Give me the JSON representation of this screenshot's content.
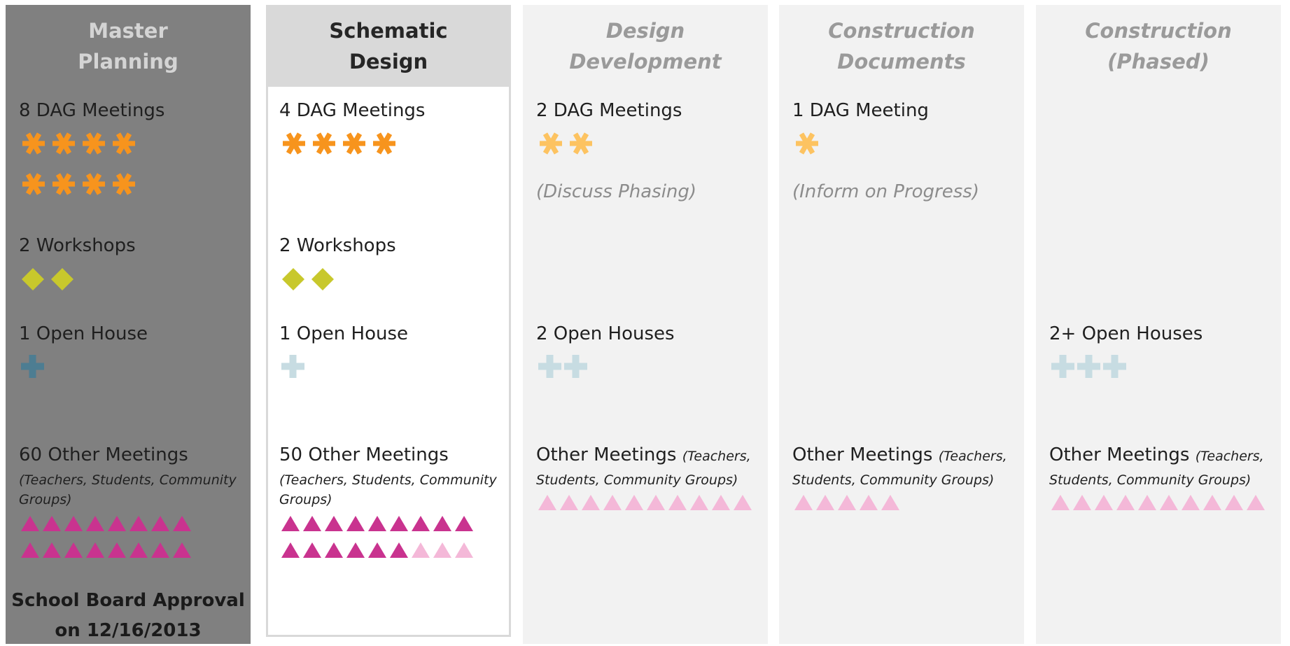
{
  "colors": {
    "dag_strong": "#f7941d",
    "dag_light": "#fdc361",
    "workshop": "#c8c82c",
    "openhouse_strong": "#4d7d92",
    "openhouse_light": "#c7dce2",
    "other_strong": "#c9338f",
    "other_light": "#f4b8d8"
  },
  "phases": [
    {
      "title": "Master\nPlanning",
      "dag_label": "8 DAG Meetings",
      "dag_rows": [
        {
          "strong": 4,
          "light": 0
        },
        {
          "strong": 4,
          "light": 0
        }
      ],
      "workshop_label": "2 Workshops",
      "workshop_count": 2,
      "openhouse_label": "1 Open House",
      "openhouse": {
        "strong": 1,
        "light": 0
      },
      "other_label": "60 Other Meetings",
      "other_sub": "(Teachers, Students, Community Groups)",
      "other_rows": [
        {
          "strong": 8,
          "light": 0
        },
        {
          "strong": 8,
          "light": 0
        }
      ],
      "approval": "School Board Approval\non 12/16/2013"
    },
    {
      "title": "Schematic\nDesign",
      "dag_label": "4 DAG Meetings",
      "dag_rows": [
        {
          "strong": 4,
          "light": 0
        }
      ],
      "workshop_label": "2 Workshops",
      "workshop_count": 2,
      "openhouse_label": "1 Open House",
      "openhouse": {
        "strong": 0,
        "light": 1
      },
      "other_label": "50 Other Meetings",
      "other_sub": "(Teachers, Students, Community Groups)",
      "other_rows": [
        {
          "strong": 9,
          "light": 0
        },
        {
          "strong": 6,
          "light": 3
        }
      ]
    },
    {
      "title": "Design\nDevelopment",
      "dag_label": "2 DAG Meetings",
      "dag_rows": [
        {
          "strong": 0,
          "light": 2
        }
      ],
      "dag_note": "(Discuss Phasing)",
      "openhouse_label": "2 Open Houses",
      "openhouse": {
        "strong": 0,
        "light": 2
      },
      "other_label": "Other Meetings",
      "other_inline": "(Teachers,",
      "other_sub": "Students, Community Groups)",
      "other_rows": [
        {
          "strong": 0,
          "light": 10
        }
      ]
    },
    {
      "title": "Construction\nDocuments",
      "dag_label": "1 DAG Meeting",
      "dag_rows": [
        {
          "strong": 0,
          "light": 1
        }
      ],
      "dag_note": "(Inform on Progress)",
      "other_label": "Other Meetings",
      "other_inline": "(Teachers,",
      "other_sub": "Students, Community Groups)",
      "other_rows": [
        {
          "strong": 0,
          "light": 5
        }
      ]
    },
    {
      "title": "Construction\n(Phased)",
      "openhouse_label": "2+ Open Houses",
      "openhouse": {
        "strong": 0,
        "light": 3
      },
      "other_label": "Other Meetings",
      "other_inline": "(Teachers,",
      "other_sub": "Students, Community Groups)",
      "other_rows": [
        {
          "strong": 0,
          "light": 10
        }
      ]
    }
  ]
}
